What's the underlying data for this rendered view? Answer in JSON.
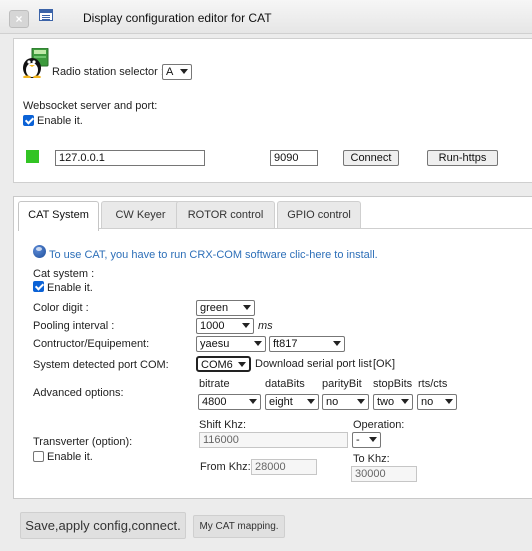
{
  "window": {
    "title": "Display configuration editor for CAT"
  },
  "station": {
    "label": "Radio station selector :",
    "selected": "A"
  },
  "websocket": {
    "label": "Websocket server and port:",
    "enable_label": "Enable it.",
    "host": "127.0.0.1",
    "port": "9090",
    "connect_label": "Connect",
    "run_https_label": "Run-https",
    "status_color": "#32c424"
  },
  "tabs": [
    {
      "label": "CAT System"
    },
    {
      "label": "CW Keyer"
    },
    {
      "label": "ROTOR control"
    },
    {
      "label": "GPIO control"
    }
  ],
  "cat": {
    "info_text": "To use CAT, you have to run CRX-COM software clic-here to install.",
    "system_label": "Cat system :",
    "enable_label": "Enable it.",
    "color_digit_label": "Color digit :",
    "color_digit_value": "green",
    "pooling_label": "Pooling interval :",
    "pooling_value": "1000",
    "pooling_unit": "ms",
    "contructor_label": "Contructor/Equipement:",
    "contructor_value": "yaesu",
    "equipment_value": "ft817",
    "port_label": "System detected port COM:",
    "port_value": "COM6",
    "download_text": "Download serial port list",
    "ok_text": "[OK]",
    "advanced_label": "Advanced options:",
    "advanced": {
      "bitrate_label": "bitrate",
      "bitrate_value": "4800",
      "databits_label": "dataBits",
      "databits_value": "eight",
      "parity_label": "parityBit",
      "parity_value": "no",
      "stopbits_label": "stopBits",
      "stopbits_value": "two",
      "rtscts_label": "rts/cts",
      "rtscts_value": "no"
    },
    "transverter_label": "Transverter (option):",
    "transverter_enable_label": "Enable it.",
    "shift_label": "Shift Khz:",
    "shift_value": "116000",
    "operation_label": "Operation:",
    "operation_value": "-",
    "from_label": "From Khz:",
    "from_value": "28000",
    "to_label": "To Khz:",
    "to_value": "30000"
  },
  "footer": {
    "save_label": "Save,apply config,connect.",
    "mapping_label": "My CAT mapping."
  }
}
